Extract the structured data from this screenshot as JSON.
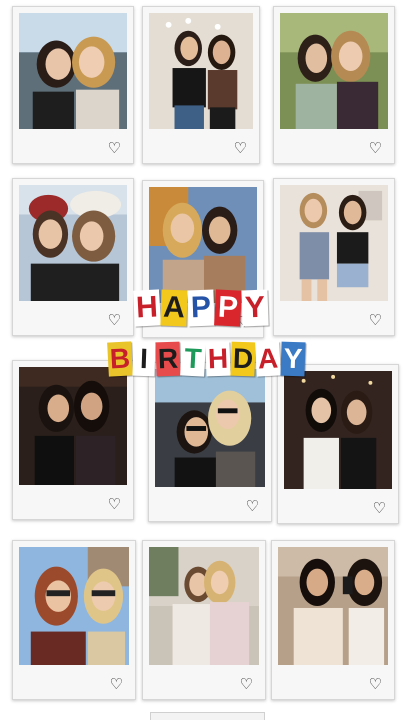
{
  "collage": {
    "heart_icon": "heart-outline-icon",
    "banner_line1": [
      "H",
      "A",
      "P",
      "P",
      "Y"
    ],
    "banner_line2": [
      "B",
      "I",
      "R",
      "T",
      "H",
      "D",
      "A",
      "Y"
    ],
    "heart_glyph": "♡"
  }
}
